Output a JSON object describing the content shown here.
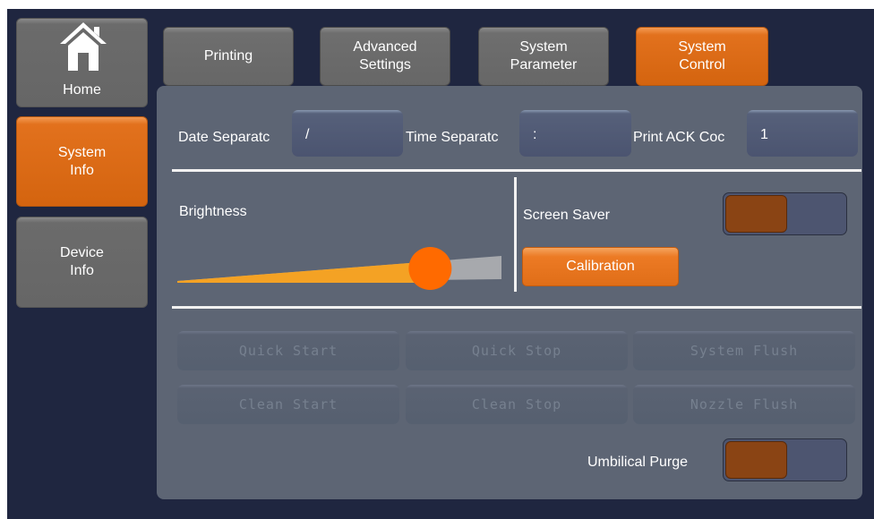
{
  "sidebar": {
    "home_label": "Home",
    "system_info_line1": "System",
    "system_info_line2": "Info",
    "device_info_line1": "Device",
    "device_info_line2": "Info"
  },
  "tabs": {
    "printing": "Printing",
    "advanced_line1": "Advanced",
    "advanced_line2": "Settings",
    "param_line1": "System",
    "param_line2": "Parameter",
    "control_line1": "System",
    "control_line2": "Control"
  },
  "settings": {
    "date_sep_label": "Date Separatc",
    "date_sep_value": "/",
    "time_sep_label": "Time Separatc",
    "time_sep_value": ":",
    "ack_label": "Print ACK Coc",
    "ack_value": "1"
  },
  "brightness": {
    "label": "Brightness",
    "level": 0.78
  },
  "screen_saver": {
    "label": "Screen Saver",
    "on": true
  },
  "calibration_label": "Calibration",
  "actions": {
    "quick_start": "Quick Start",
    "quick_stop": "Quick Stop",
    "system_flush": "System Flush",
    "clean_start": "Clean Start",
    "clean_stop": "Clean Stop",
    "nozzle_flush": "Nozzle Flush"
  },
  "umbilical": {
    "label": "Umbilical Purge",
    "on": true
  },
  "colors": {
    "accent_orange": "#e2711d",
    "background_navy": "#1f2640",
    "panel_gray": "#5d6574",
    "toggle_on": "#8a4414"
  },
  "icons": {
    "home": "house-icon"
  }
}
